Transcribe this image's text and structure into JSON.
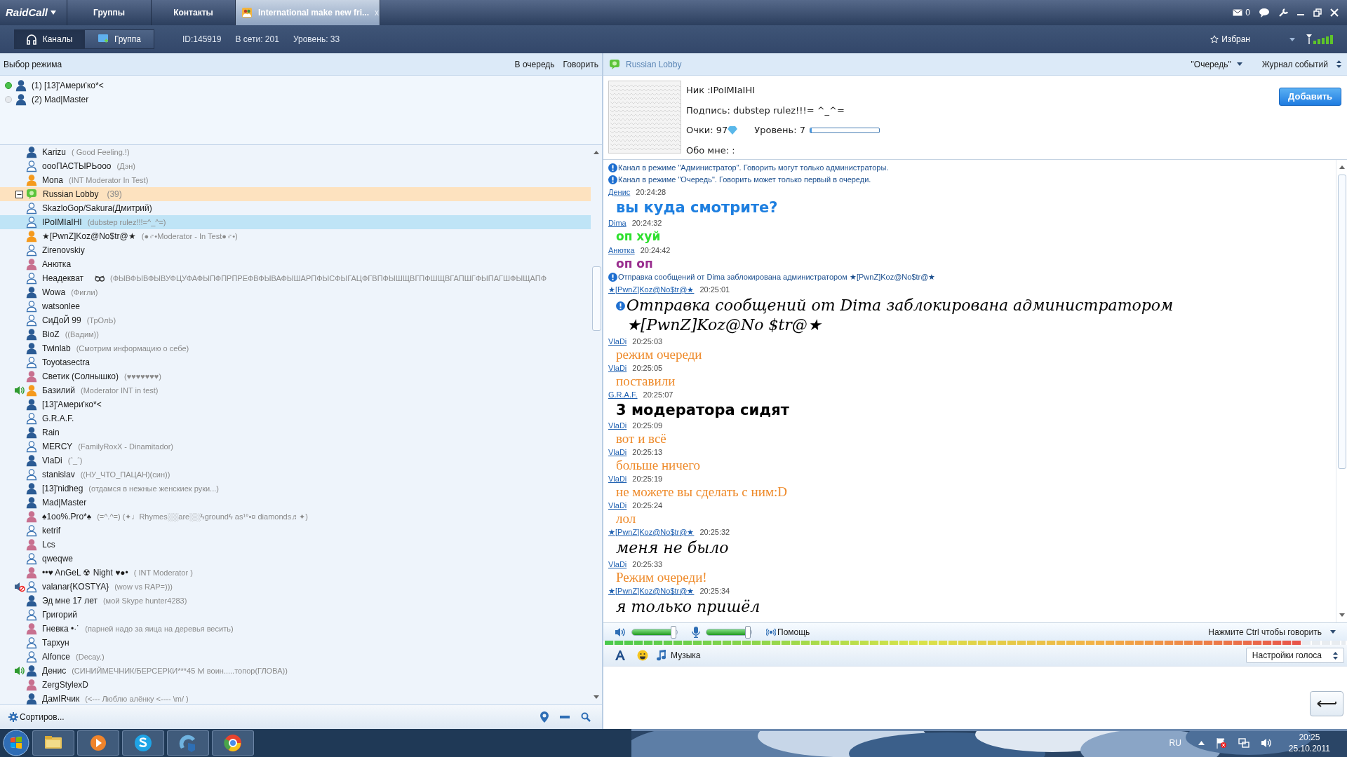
{
  "app": {
    "logo": "RaidCall",
    "tabs": [
      {
        "label": "Группы",
        "selected": false
      },
      {
        "label": "Контакты",
        "selected": false
      },
      {
        "label": "International make new fri...",
        "selected": true,
        "close": "x"
      }
    ],
    "mail_count": "0"
  },
  "toolbar": {
    "buttons": [
      {
        "label": "Каналы",
        "selected": true
      },
      {
        "label": "Группа",
        "selected": false
      }
    ],
    "stats": [
      "ID:145919",
      "В сети: 201",
      "Уровень: 33"
    ],
    "favorites": "Избран"
  },
  "left": {
    "header": "Выбор режима",
    "actions": [
      "В очередь",
      "Говорить"
    ],
    "queue": [
      {
        "label": "(1) [13]'Амери'ко*<",
        "active": true
      },
      {
        "label": "(2) Mad|Master",
        "active": false
      }
    ],
    "users": [
      {
        "kind": "member",
        "name": "Karizu",
        "status": "( Good Feeling.!)",
        "selected": false
      },
      {
        "kind": "guest",
        "name": "oooПАСТЫРЬooo",
        "status": "(Дэн)",
        "selected": false
      },
      {
        "kind": "moderator",
        "name": "Mona",
        "status": "(INT Moderator In Test)",
        "selected": false
      },
      {
        "kind": "channel",
        "name": "Russian Lobby",
        "count": "(39)",
        "expanded": true,
        "selected": false
      },
      {
        "kind": "guest",
        "name": "SkazloGop/Sakura(Дмитрий)",
        "selected": false
      },
      {
        "kind": "guest",
        "name": "IPoIMIaIHI",
        "status": "(dubstep rulez!!!=^_^=)",
        "selected": true
      },
      {
        "kind": "moderator",
        "name": "★[PwnZ]Koz@No$tr@★",
        "status": "(●♂•Moderator - In Test●♂•)",
        "selected": false
      },
      {
        "kind": "guest",
        "name": "Zirenovskiy",
        "selected": false
      },
      {
        "kind": "female",
        "name": "Анютка",
        "selected": false
      },
      {
        "kind": "guest",
        "name": "Неадекват",
        "emblem": true,
        "status": "(ФЫВФЫВФЫВУФЦУФАФЫПФПРПРЕФВФЫВАФЫШАРПФЫСФЫГАЦФГВПФЫШЩВГПФШЩВГАПШГФЫПАГШФЫЩАПФ",
        "selected": false
      },
      {
        "kind": "member",
        "name": "Wowa",
        "status": "(Фигли)",
        "selected": false
      },
      {
        "kind": "guest",
        "name": "watsonlee",
        "selected": false
      },
      {
        "kind": "guest",
        "name": "СиДоЙ 99",
        "status": "(ТрОлЬ)",
        "selected": false
      },
      {
        "kind": "member",
        "name": "BioZ",
        "status": "((Вадим))",
        "selected": false
      },
      {
        "kind": "member",
        "name": "Twinlab",
        "status": "(Смотрим информацию о себе)",
        "selected": false
      },
      {
        "kind": "guest",
        "name": "Toyotasectra",
        "selected": false
      },
      {
        "kind": "female",
        "name": "Светик (Солнышко)",
        "status": "(♥♥♥♥♥♥♥)",
        "selected": false
      },
      {
        "kind": "moderator",
        "name": "Базилий",
        "status": "(Moderator INT in test)",
        "speaking": true,
        "selected": false
      },
      {
        "kind": "member",
        "name": "[13]'Амери'ко*<",
        "selected": false
      },
      {
        "kind": "guest",
        "name": "G.R.A.F.",
        "selected": false
      },
      {
        "kind": "member",
        "name": "Rain",
        "selected": false
      },
      {
        "kind": "guest",
        "name": "MERCY",
        "status": "(FamilyRoxX - Dinamitador)",
        "selected": false
      },
      {
        "kind": "member",
        "name": "VlaDi",
        "status": "(ˆ_ˆ)",
        "selected": false
      },
      {
        "kind": "guest",
        "name": "stanislav",
        "status": "((НУ_ЧТО_ПАЦАН)(син))",
        "selected": false
      },
      {
        "kind": "member",
        "name": "[13]'nidheg",
        "status": "(отдамся в нежные женскиек руки...)",
        "selected": false
      },
      {
        "kind": "member",
        "name": "Mad|Master",
        "selected": false
      },
      {
        "kind": "female",
        "name": "♠1oo%.Pro*♠",
        "status": "(=^.^=) (✦♩Rhymes░░are░░ϟgroundϟ as¹°•¤ diamonds♬✦)",
        "selected": false
      },
      {
        "kind": "guest",
        "name": "ketrif",
        "selected": false
      },
      {
        "kind": "female",
        "name": "Lcs",
        "selected": false
      },
      {
        "kind": "guest",
        "name": "qweqwe",
        "selected": false
      },
      {
        "kind": "female",
        "name": "••♥ AnGeL ☢ Night ♥●•",
        "status": "( INT Moderator )",
        "selected": false
      },
      {
        "kind": "guest",
        "name": "valanar{KOSTYA}",
        "status": "(wow vs RAP=)))",
        "muted": true,
        "selected": false
      },
      {
        "kind": "member",
        "name": "Эд мне 17 лет",
        "status": "(мой Skype hunter4283)",
        "selected": false
      },
      {
        "kind": "guest",
        "name": "Григорий",
        "selected": false
      },
      {
        "kind": "female",
        "name": "Гневка •·˙",
        "status": "(парней надо за яица на деревья весить)",
        "selected": false
      },
      {
        "kind": "guest",
        "name": "Тархун",
        "selected": false
      },
      {
        "kind": "guest",
        "name": "Alfonce",
        "status": "(Decay.)",
        "selected": false
      },
      {
        "kind": "member",
        "name": "Денис",
        "status": "(СИНИЙМЕЧНИК/БЕРСЕРКИ***45 lvl воин.....топор(ГЛОВА))",
        "speaking": true,
        "selected": false
      },
      {
        "kind": "female",
        "name": "ZergStylexD",
        "selected": false
      },
      {
        "kind": "member",
        "name": "ДамIRчик",
        "status": "(<--- Люблю алёнку <---- \\m/ )",
        "selected": false
      }
    ],
    "sort": "Сортиров..."
  },
  "right": {
    "channel": "Russian Lobby",
    "mode": "\"Очередь\"",
    "log": "Журнал событий",
    "profile": {
      "nick": "Ник :IPoIMIaIHI",
      "signature": "Подпись: dubstep rulez!!!= ^_^=",
      "points": "Очки: 97",
      "level_label": "Уровень: 7",
      "level": 0,
      "about": "Обо мне: :",
      "add": "Добавить"
    },
    "chat": [
      {
        "kind": "system",
        "text": "Канал в режиме \"Администратор\". Говорить могут только администраторы."
      },
      {
        "kind": "system",
        "text": "Канал в режиме \"Очередь\". Говорить может только первый в очереди."
      },
      {
        "kind": "header",
        "author": "Денис",
        "time": "20:24:28"
      },
      {
        "kind": "sans",
        "color": "#1e7fe0",
        "text": "вы куда смотрите?"
      },
      {
        "kind": "header",
        "author": "Dima",
        "time": "20:24:32"
      },
      {
        "kind": "round",
        "color": "#2ee02e",
        "text": "оп хуй"
      },
      {
        "kind": "header",
        "author": "Анютка",
        "time": "20:24:42"
      },
      {
        "kind": "round",
        "color": "#9a2f8f",
        "text": "оп оп"
      },
      {
        "kind": "system",
        "text": "Отправка сообщений от Dima заблокирована администратором ★[PwnZ]Koz@No$tr@★"
      },
      {
        "kind": "header",
        "author": "★[PwnZ]Koz@No$tr@★",
        "time": "20:25:01"
      },
      {
        "kind": "script",
        "color": "#000000",
        "info": true,
        "text": "Отправка сообщений от Dima заблокирована администратором ★[PwnZ]Koz@No $tr@★"
      },
      {
        "kind": "header",
        "author": "VlaDi",
        "time": "20:25:03"
      },
      {
        "kind": "serif",
        "color": "#ee8a2a",
        "text": "режим очереди"
      },
      {
        "kind": "header",
        "author": "VlaDi",
        "time": "20:25:05"
      },
      {
        "kind": "serif",
        "color": "#ee8a2a",
        "text": "поставили"
      },
      {
        "kind": "header",
        "author": "G.R.A.F.",
        "time": "20:25:07"
      },
      {
        "kind": "sans",
        "color": "#000000",
        "text": "3 модератора сидят"
      },
      {
        "kind": "header",
        "author": "VlaDi",
        "time": "20:25:09"
      },
      {
        "kind": "serif",
        "color": "#ee8a2a",
        "text": "вот и всё"
      },
      {
        "kind": "header",
        "author": "VlaDi",
        "time": "20:25:13"
      },
      {
        "kind": "serif",
        "color": "#ee8a2a",
        "text": "больше ничего"
      },
      {
        "kind": "header",
        "author": "VlaDi",
        "time": "20:25:19"
      },
      {
        "kind": "serif",
        "color": "#ee8a2a",
        "text": "не можете вы сделать с ним:D"
      },
      {
        "kind": "header",
        "author": "VlaDi",
        "time": "20:25:24"
      },
      {
        "kind": "serif",
        "color": "#ee8a2a",
        "text": "лол"
      },
      {
        "kind": "header",
        "author": "★[PwnZ]Koz@No$tr@★",
        "time": "20:25:32"
      },
      {
        "kind": "script",
        "color": "#000000",
        "text": "меня не было"
      },
      {
        "kind": "header",
        "author": "VlaDi",
        "time": "20:25:33"
      },
      {
        "kind": "serif",
        "color": "#ee8a2a",
        "text": "Режим очереди!"
      },
      {
        "kind": "header",
        "author": "★[PwnZ]Koz@No$tr@★",
        "time": "20:25:34"
      },
      {
        "kind": "script",
        "color": "#000000",
        "text": "я только пришёл"
      }
    ],
    "voice": {
      "speaker": {
        "level": 0.92
      },
      "mic": {
        "level": 0.92
      },
      "help": "Помощь",
      "hint": "Нажмите Ctrl чтобы говорить",
      "meter": {
        "level": 0.94
      }
    },
    "tools": {
      "music": "Музыка",
      "voice_settings": "Настройки голоса"
    }
  },
  "taskbar": {
    "apps": [
      {
        "kind": "explorer"
      },
      {
        "kind": "player"
      },
      {
        "kind": "skype"
      },
      {
        "kind": "raidcall"
      },
      {
        "kind": "browser"
      }
    ],
    "lang": "RU",
    "time": "20:25",
    "date": "25.10.2011"
  }
}
